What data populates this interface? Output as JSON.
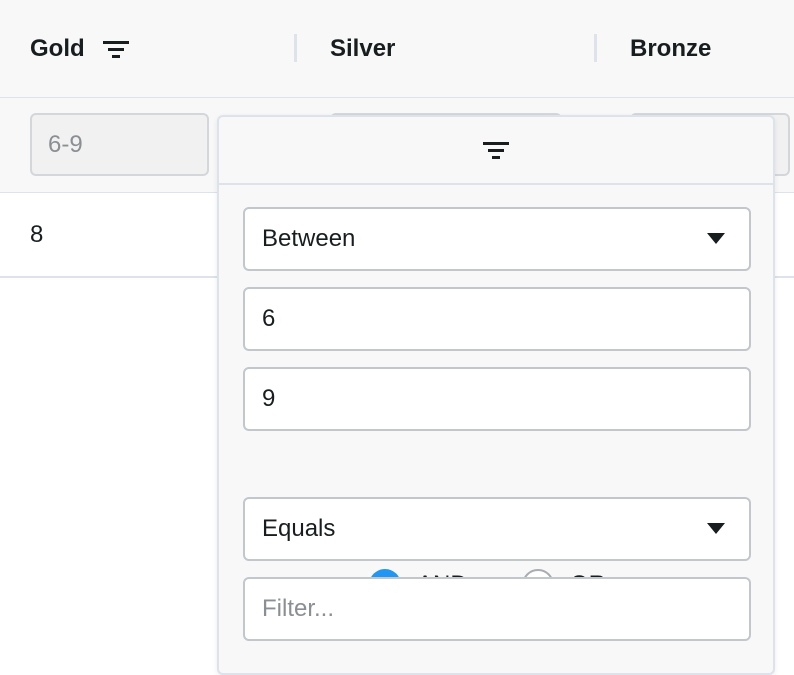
{
  "columns": [
    {
      "label": "Gold",
      "has_filter_icon": true
    },
    {
      "label": "Silver"
    },
    {
      "label": "Bronze"
    }
  ],
  "floating_filter": {
    "gold_value": "6-9"
  },
  "rows": [
    {
      "gold": "8"
    }
  ],
  "filter_menu": {
    "tab_icon": "filter-icon",
    "condition1": {
      "type": "Between",
      "from": "6",
      "to": "9"
    },
    "join": {
      "and_label": "AND",
      "or_label": "OR",
      "selected": "AND"
    },
    "condition2": {
      "type": "Equals",
      "placeholder": "Filter..."
    }
  },
  "colors": {
    "accent": "#2196f3",
    "header_bg": "#f8f8f8",
    "border": "#dde2eb"
  }
}
